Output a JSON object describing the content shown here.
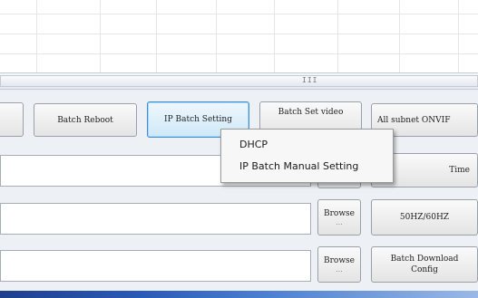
{
  "toolbar": {
    "batch_reboot": "Batch Reboot",
    "ip_batch_setting": "IP Batch Setting",
    "batch_set_video": "Batch Set video",
    "all_subnet_onvif": "All subnet ONVIF",
    "time_partial": "Time"
  },
  "rows": [
    {
      "browse_label": "Browse",
      "browse_dots": "...",
      "action_label": "50HZ/60HZ"
    },
    {
      "browse_label": "Browse",
      "browse_dots": "...",
      "action_label": "Batch Download Config"
    }
  ],
  "scrollbar": {
    "grip": "III"
  },
  "context_menu": {
    "items": [
      "DHCP",
      "IP Batch Manual Setting"
    ]
  },
  "colors": {
    "accent": "#3c8fd0",
    "taskbar": "#2a5bb8"
  }
}
